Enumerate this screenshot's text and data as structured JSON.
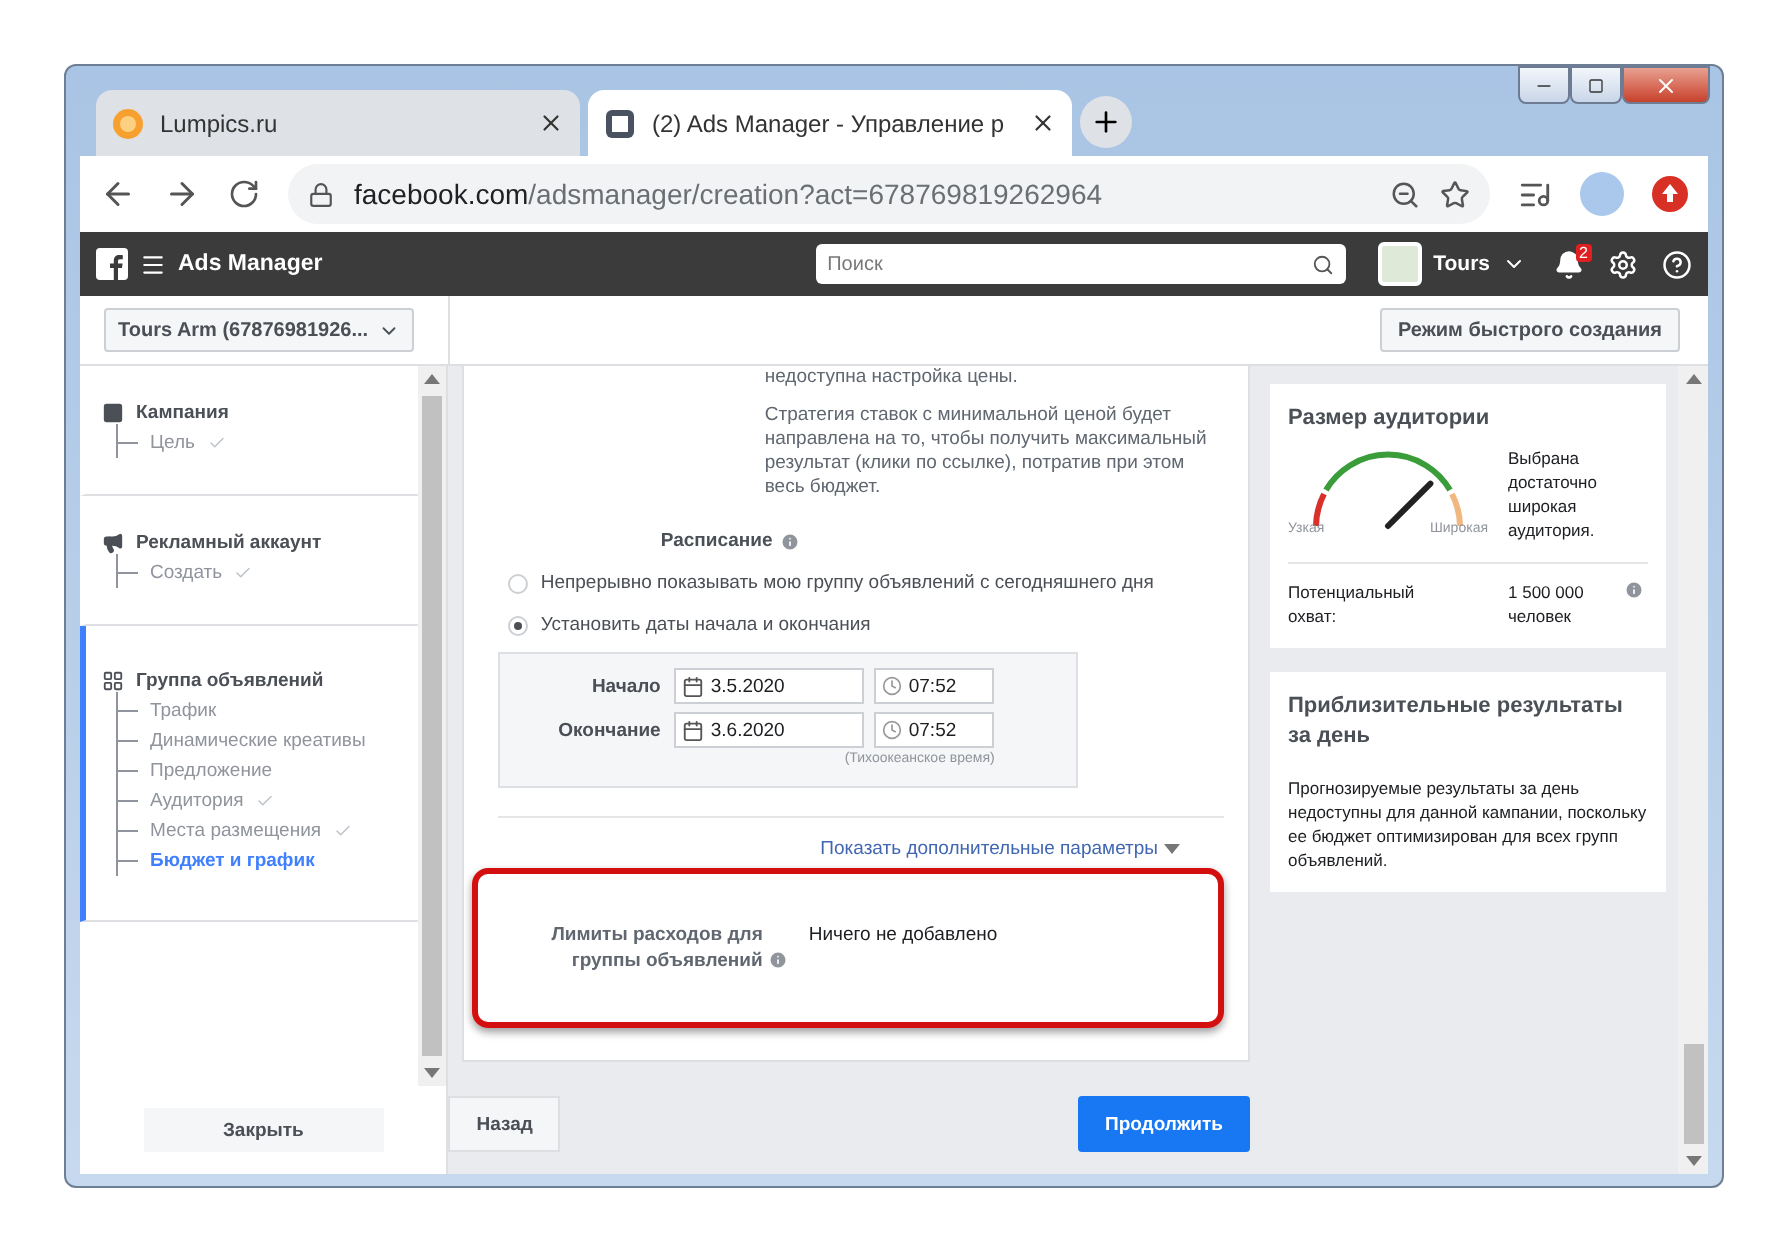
{
  "browser": {
    "tabs": [
      {
        "title": "Lumpics.ru",
        "kind": "orange",
        "selected": false
      },
      {
        "title": "(2) Ads Manager - Управление р",
        "kind": "page",
        "selected": true
      }
    ],
    "url": {
      "host": "facebook.com",
      "path": "/adsmanager/creation?act=678769819262964"
    }
  },
  "header": {
    "title": "Ads Manager",
    "search": {
      "placeholder": "Поиск"
    },
    "user": "Tours",
    "notifications": "2"
  },
  "subheader": {
    "account": "Tours Arm (67876981926...",
    "quick_button": "Режим быстрого создания"
  },
  "sidebar": {
    "sections": [
      {
        "title": "Кампания",
        "kind": "campaign",
        "active": false,
        "steps": [
          {
            "label": "Цель",
            "done": true,
            "selected": false
          }
        ]
      },
      {
        "title": "Рекламный аккаунт",
        "kind": "account",
        "active": false,
        "steps": [
          {
            "label": "Создать",
            "done": true,
            "selected": false
          }
        ]
      },
      {
        "title": "Группа объявлений",
        "kind": "adset",
        "active": true,
        "steps": [
          {
            "label": "Трафик",
            "done": false,
            "selected": false
          },
          {
            "label": "Динамические креативы",
            "done": false,
            "selected": false
          },
          {
            "label": "Предложение",
            "done": false,
            "selected": false
          },
          {
            "label": "Аудитория",
            "done": true,
            "selected": false
          },
          {
            "label": "Места размещения",
            "done": true,
            "selected": false
          },
          {
            "label": "Бюджет и график",
            "done": false,
            "selected": true
          }
        ]
      }
    ],
    "close_button": "Закрыть"
  },
  "form": {
    "notes": [
      "недоступна настройка цены.",
      "Стратегия ставок с минимальной ценой будет направлена на то, чтобы получить максимальный результат (клики по ссылке), потратив при этом весь бюджет."
    ],
    "schedule": {
      "label": "Расписание",
      "options": [
        {
          "label": "Непрерывно показывать мою группу объявлений с сегодняшнего дня",
          "selected": false
        },
        {
          "label": "Установить даты начала и окончания",
          "selected": true
        }
      ],
      "dates": [
        {
          "label": "Начало",
          "date": "3.5.2020",
          "time": "07:52"
        },
        {
          "label": "Окончание",
          "date": "3.6.2020",
          "time": "07:52"
        }
      ],
      "timezone": "(Тихоокеанское время)"
    },
    "more_link": "Показать дополнительные параметры",
    "spend_limits": {
      "label": "Лимиты расходов для группы объявлений",
      "value": "Ничего не добавлено",
      "highlighted": true
    },
    "back_button": "Назад",
    "next_button": "Продолжить"
  },
  "audience": {
    "title": "Размер аудитории",
    "gauge": {
      "level": 0.75,
      "narrow": "Узкая",
      "wide": "Широкая"
    },
    "description": "Выбрана достаточно широкая аудитория.",
    "reach_label": "Потенциальный охват:",
    "reach_value": "1 500 000 человек"
  },
  "estimate": {
    "title": "Приблизительные результаты за день",
    "text": "Прогнозируемые результаты за день недоступны для данной кампании, поскольку ее бюджет оптимизирован для всех групп объявлений."
  }
}
